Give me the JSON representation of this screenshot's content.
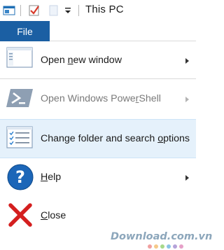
{
  "window": {
    "title": "This PC"
  },
  "ribbon": {
    "file_tab_label": "File"
  },
  "menu": {
    "items": [
      {
        "pre": "Open ",
        "accel": "n",
        "post": "ew window",
        "icon": "new-window-icon",
        "has_submenu": true,
        "enabled": true
      },
      {
        "pre": "Open Windows Powe",
        "accel": "r",
        "post": "Shell",
        "icon": "powershell-icon",
        "has_submenu": true,
        "enabled": false
      },
      {
        "pre": "Change folder and search ",
        "accel": "o",
        "post": "ptions",
        "icon": "folder-options-icon",
        "has_submenu": false,
        "enabled": true
      },
      {
        "pre": "",
        "accel": "H",
        "post": "elp",
        "icon": "help-icon",
        "has_submenu": true,
        "enabled": true
      },
      {
        "pre": "",
        "accel": "C",
        "post": "lose",
        "icon": "close-icon",
        "has_submenu": false,
        "enabled": true
      }
    ]
  },
  "watermark": {
    "text": "Download.com.vn",
    "dot_colors": [
      "#f0a0a0",
      "#f5c98a",
      "#a8d98a",
      "#8ac4e6",
      "#b5a3d9",
      "#e6a0c8"
    ]
  },
  "colors": {
    "file_tab": "#1b5fa3",
    "highlight": "#e5f1fb"
  }
}
